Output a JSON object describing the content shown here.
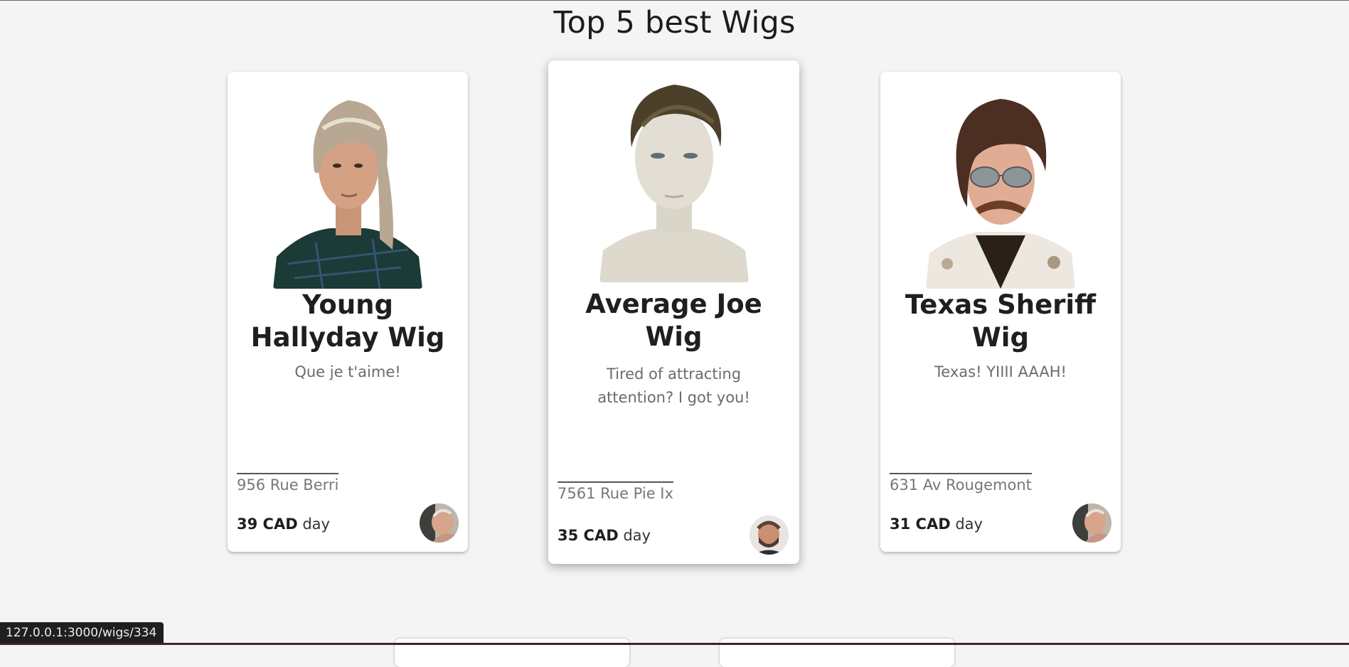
{
  "page": {
    "title": "Top 5 best Wigs"
  },
  "cards": [
    {
      "title": "Young Hallyday Wig",
      "description": "Que je t'aime!",
      "address": "956 Rue Berri",
      "price": "39 CAD",
      "period": "day",
      "avatar": "elderly-man-avatar"
    },
    {
      "title": "Average Joe Wig",
      "description": "Tired of attracting attention? I got you!",
      "address": "7561 Rue Pie Ix",
      "price": "35 CAD",
      "period": "day",
      "avatar": "bearded-man-avatar"
    },
    {
      "title": "Texas Sheriff Wig",
      "description": "Texas! YIIII AAAH!",
      "address": "631 Av Rougemont",
      "price": "31 CAD",
      "period": "day",
      "avatar": "elderly-man-avatar"
    }
  ],
  "status_bar": {
    "url": "127.0.0.1:3000/wigs/334"
  }
}
